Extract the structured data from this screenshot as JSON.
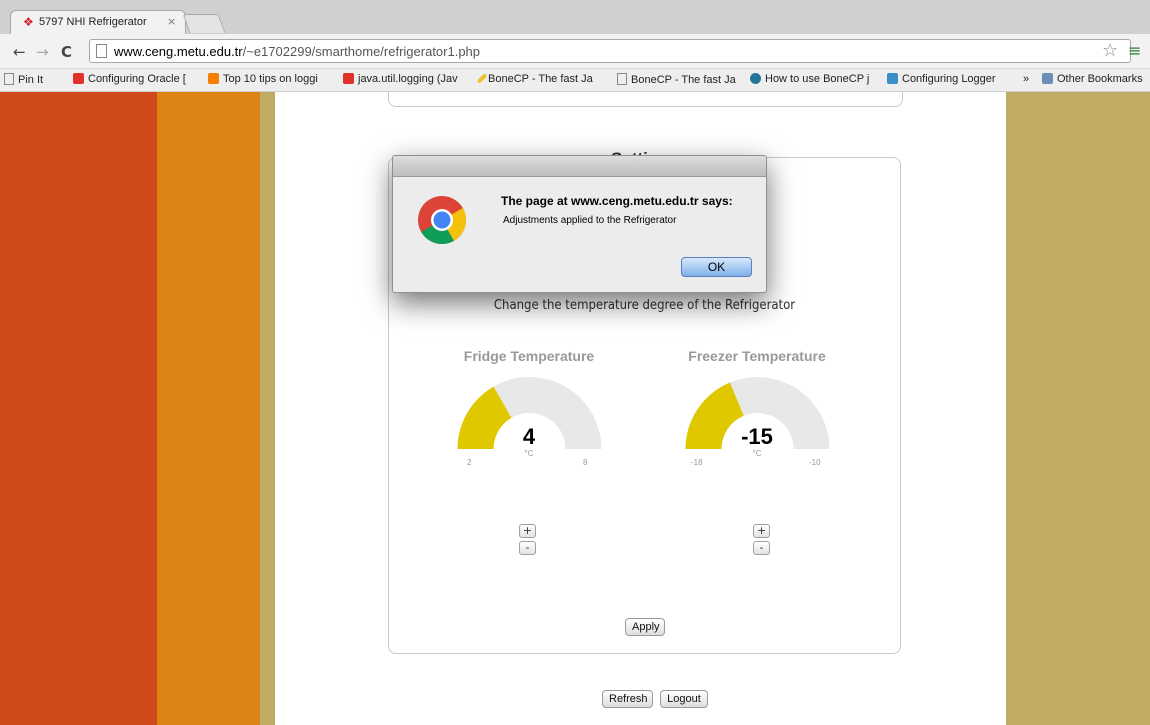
{
  "browser": {
    "tab_title": "5797 NHI Refrigerator",
    "tab_close": "×",
    "url_host": "www.ceng.metu.edu.tr",
    "url_path": "/~e1702299/smarthome/refrigerator1.php",
    "back_glyph": "←",
    "forward_glyph": "→",
    "reload_glyph": "C",
    "star_glyph": "☆",
    "menu_glyph": "≡",
    "bookmarks": [
      {
        "label": "Pin It",
        "icon": "page-icon",
        "color": "#ffffff"
      },
      {
        "label": "Configuring Oracle [",
        "icon": "oracle-icon",
        "color": "#e0302a"
      },
      {
        "label": "Top 10 tips on loggi",
        "icon": "blogger-icon",
        "color": "#f57d00"
      },
      {
        "label": "java.util.logging (Jav",
        "icon": "oracle-icon",
        "color": "#e0302a"
      },
      {
        "label": "BoneCP - The fast Ja",
        "icon": "pen-icon",
        "color": "#f1c232"
      },
      {
        "label": "BoneCP - The fast Ja",
        "icon": "page-icon",
        "color": "#ffffff"
      },
      {
        "label": "How to use BoneCP j",
        "icon": "wordpress-icon",
        "color": "#21759b"
      },
      {
        "label": "Configuring Logger",
        "icon": "hn-icon",
        "color": "#3b8fc8"
      }
    ],
    "overflow": "»",
    "other_bookmarks": "Other Bookmarks"
  },
  "colors": {
    "stripe_red": "#cf4a18",
    "stripe_orange": "#dd8313",
    "stripe_olive": "#c0ab63",
    "gauge_fill": "#e0c800",
    "gauge_track": "#e8e8e8"
  },
  "page": {
    "settings_title": "Settings",
    "description": "Change the temperature degree of the Refrigerator",
    "fridge": {
      "title": "Fridge Temperature",
      "value": "4",
      "unit": "°C",
      "min": "2",
      "max": "8",
      "level": 0.3333
    },
    "freezer": {
      "title": "Freezer Temperature",
      "value": "-15",
      "unit": "°C",
      "min": "-18",
      "max": "-10",
      "level": 0.375
    },
    "plus_label": "+",
    "minus_label": "-",
    "apply_label": "Apply",
    "refresh_label": "Refresh",
    "logout_label": "Logout"
  },
  "dialog": {
    "heading": "The page at www.ceng.metu.edu.tr says:",
    "message": "Adjustments applied to the Refrigerator",
    "ok_label": "OK"
  }
}
